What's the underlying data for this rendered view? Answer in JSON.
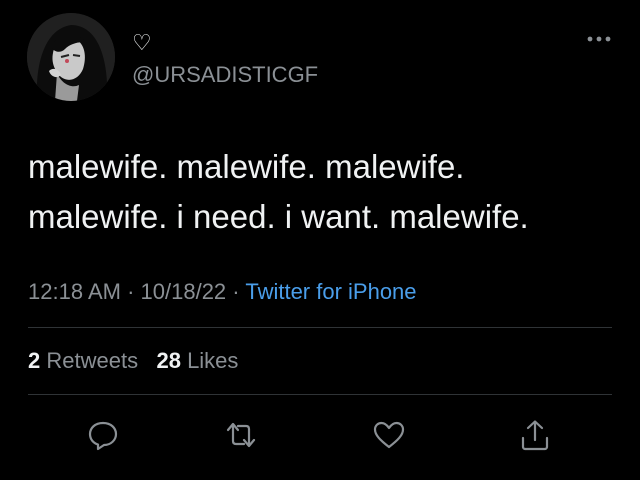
{
  "author": {
    "display_name": "♡",
    "handle": "@URSADISTICGF"
  },
  "tweet": {
    "text": "malewife. malewife. malewife.\nmalewife. i need. i want. malewife."
  },
  "meta": {
    "time": "12:18 AM",
    "date": "10/18/22",
    "separator": "·",
    "source": "Twitter for iPhone"
  },
  "stats": {
    "retweets_count": "2",
    "retweets_label": "Retweets",
    "likes_count": "28",
    "likes_label": "Likes"
  },
  "actions": {
    "reply_icon": "reply-icon",
    "retweet_icon": "retweet-icon",
    "like_icon": "heart-icon",
    "share_icon": "share-icon"
  },
  "colors": {
    "background": "#000000",
    "text": "#e7e9ea",
    "muted": "#8b9095",
    "link": "#4a9eea"
  }
}
